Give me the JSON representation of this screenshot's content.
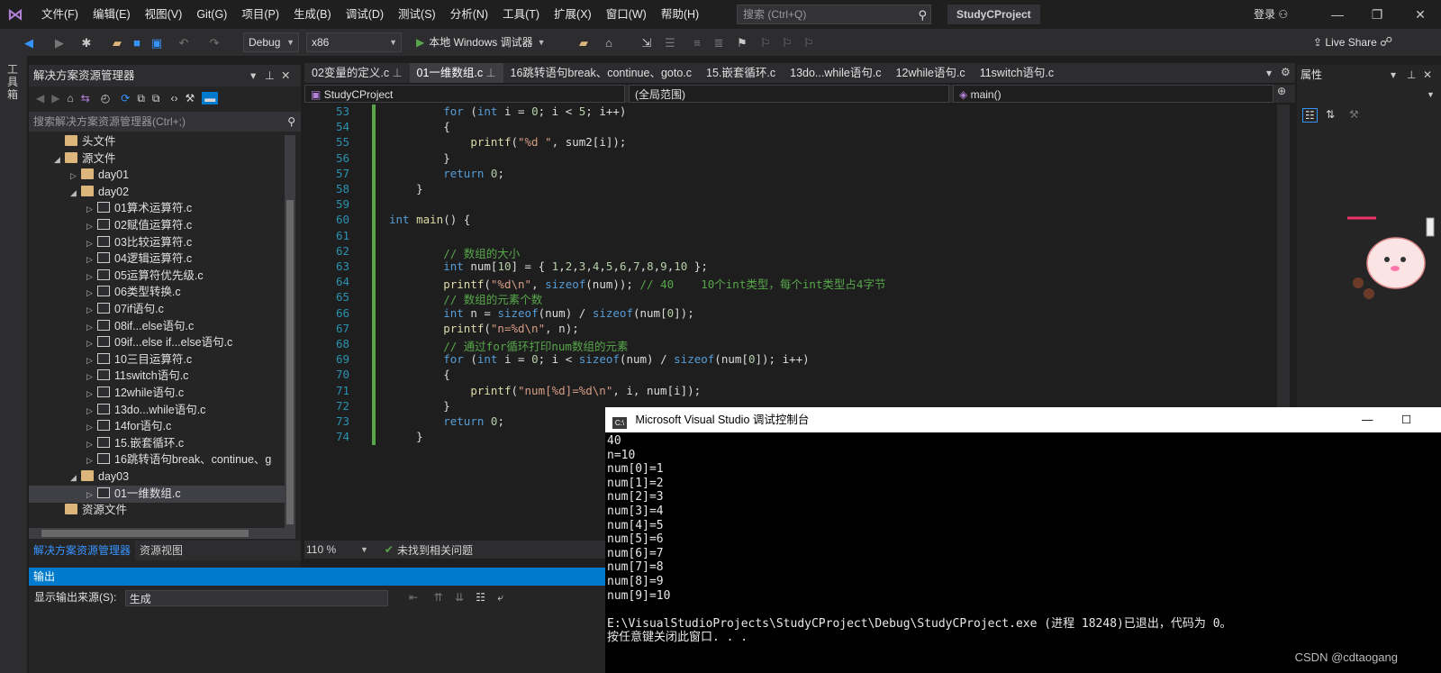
{
  "menubar": {
    "items": [
      "文件(F)",
      "编辑(E)",
      "视图(V)",
      "Git(G)",
      "项目(P)",
      "生成(B)",
      "调试(D)",
      "测试(S)",
      "分析(N)",
      "工具(T)",
      "扩展(X)",
      "窗口(W)",
      "帮助(H)"
    ],
    "search_placeholder": "搜索 (Ctrl+Q)",
    "project_title": "StudyCProject",
    "login": "登录"
  },
  "toolbar": {
    "config": "Debug",
    "platform": "x86",
    "run_label": "本地 Windows 调试器",
    "live_share": "Live Share"
  },
  "left_strip": {
    "toolbox": "工具箱"
  },
  "solution_explorer": {
    "title": "解决方案资源管理器",
    "search_placeholder": "搜索解决方案资源管理器(Ctrl+;)",
    "tree": [
      {
        "label": "头文件",
        "type": "folder",
        "indent": 1,
        "twisty": ""
      },
      {
        "label": "源文件",
        "type": "folder",
        "indent": 1,
        "twisty": "◢"
      },
      {
        "label": "day01",
        "type": "folder",
        "indent": 2,
        "twisty": "▷"
      },
      {
        "label": "day02",
        "type": "folder",
        "indent": 2,
        "twisty": "◢"
      },
      {
        "label": "01算术运算符.c",
        "type": "file",
        "indent": 3,
        "twisty": "▷"
      },
      {
        "label": "02赋值运算符.c",
        "type": "file",
        "indent": 3,
        "twisty": "▷"
      },
      {
        "label": "03比较运算符.c",
        "type": "file",
        "indent": 3,
        "twisty": "▷"
      },
      {
        "label": "04逻辑运算符.c",
        "type": "file",
        "indent": 3,
        "twisty": "▷"
      },
      {
        "label": "05运算符优先级.c",
        "type": "file",
        "indent": 3,
        "twisty": "▷"
      },
      {
        "label": "06类型转换.c",
        "type": "file",
        "indent": 3,
        "twisty": "▷"
      },
      {
        "label": "07if语句.c",
        "type": "file",
        "indent": 3,
        "twisty": "▷"
      },
      {
        "label": "08if...else语句.c",
        "type": "file",
        "indent": 3,
        "twisty": "▷"
      },
      {
        "label": "09if...else if...else语句.c",
        "type": "file",
        "indent": 3,
        "twisty": "▷"
      },
      {
        "label": "10三目运算符.c",
        "type": "file",
        "indent": 3,
        "twisty": "▷"
      },
      {
        "label": "11switch语句.c",
        "type": "file",
        "indent": 3,
        "twisty": "▷"
      },
      {
        "label": "12while语句.c",
        "type": "file",
        "indent": 3,
        "twisty": "▷"
      },
      {
        "label": "13do...while语句.c",
        "type": "file",
        "indent": 3,
        "twisty": "▷"
      },
      {
        "label": "14for语句.c",
        "type": "file",
        "indent": 3,
        "twisty": "▷"
      },
      {
        "label": "15.嵌套循环.c",
        "type": "file",
        "indent": 3,
        "twisty": "▷"
      },
      {
        "label": "16跳转语句break、continue、g",
        "type": "file",
        "indent": 3,
        "twisty": "▷"
      },
      {
        "label": "day03",
        "type": "folder",
        "indent": 2,
        "twisty": "◢"
      },
      {
        "label": "01一维数组.c",
        "type": "file",
        "indent": 3,
        "twisty": "▷",
        "selected": true
      },
      {
        "label": "资源文件",
        "type": "folder",
        "indent": 1,
        "twisty": ""
      }
    ],
    "tabs": [
      "解决方案资源管理器",
      "资源视图"
    ]
  },
  "editor": {
    "tabs": [
      "02变量的定义.c",
      "01一维数组.c",
      "16跳转语句break、continue、goto.c",
      "15.嵌套循环.c",
      "13do...while语句.c",
      "12while语句.c",
      "11switch语句.c"
    ],
    "active_tab": 1,
    "nav_project": "StudyCProject",
    "nav_scope": "(全局范围)",
    "nav_function": "main()",
    "zoom": "110 %",
    "status": "未找到相关问题"
  },
  "code_lines": [
    {
      "n": "53",
      "t": "        for (int i = 0; i < 5; i++)"
    },
    {
      "n": "54",
      "t": "        {"
    },
    {
      "n": "55",
      "t": "            printf(\"%d \", sum2[i]);"
    },
    {
      "n": "56",
      "t": "        }"
    },
    {
      "n": "57",
      "t": "        return 0;"
    },
    {
      "n": "58",
      "t": "    }"
    },
    {
      "n": "59",
      "t": ""
    },
    {
      "n": "60",
      "t": "int main() {"
    },
    {
      "n": "61",
      "t": ""
    },
    {
      "n": "62",
      "t": "        // 数组的大小"
    },
    {
      "n": "63",
      "t": "        int num[10] = { 1,2,3,4,5,6,7,8,9,10 };"
    },
    {
      "n": "64",
      "t": "        printf(\"%d\\n\", sizeof(num)); // 40    10个int类型，每个int类型占4字节"
    },
    {
      "n": "65",
      "t": "        // 数组的元素个数"
    },
    {
      "n": "66",
      "t": "        int n = sizeof(num) / sizeof(num[0]);"
    },
    {
      "n": "67",
      "t": "        printf(\"n=%d\\n\", n);"
    },
    {
      "n": "68",
      "t": "        // 通过for循环打印num数组的元素"
    },
    {
      "n": "69",
      "t": "        for (int i = 0; i < sizeof(num) / sizeof(num[0]); i++)"
    },
    {
      "n": "70",
      "t": "        {"
    },
    {
      "n": "71",
      "t": "            printf(\"num[%d]=%d\\n\", i, num[i]);"
    },
    {
      "n": "72",
      "t": "        }"
    },
    {
      "n": "73",
      "t": "        return 0;"
    },
    {
      "n": "74",
      "t": "    }"
    }
  ],
  "output": {
    "title": "输出",
    "source_label": "显示输出来源(S):",
    "source_value": "生成"
  },
  "properties": {
    "title": "属性"
  },
  "console": {
    "title": "Microsoft Visual Studio 调试控制台",
    "lines": [
      "40",
      "n=10",
      "num[0]=1",
      "num[1]=2",
      "num[2]=3",
      "num[3]=4",
      "num[4]=5",
      "num[5]=6",
      "num[6]=7",
      "num[7]=8",
      "num[8]=9",
      "num[9]=10",
      "",
      "E:\\VisualStudioProjects\\StudyCProject\\Debug\\StudyCProject.exe (进程 18248)已退出，代码为 0。",
      "按任意键关闭此窗口. . ."
    ]
  },
  "watermark": "CSDN @cdtaogang"
}
